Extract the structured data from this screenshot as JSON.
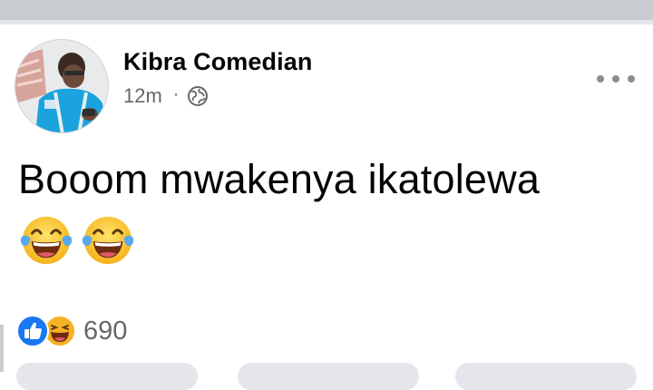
{
  "post": {
    "author": "Kibra Comedian",
    "time": "12m",
    "separator": "·",
    "privacy_icon": "globe-icon",
    "more_icon": "more-horizontal-icon",
    "text": "Booom mwakenya ikatolewa",
    "emojis": [
      "tears-of-joy-emoji",
      "tears-of-joy-emoji"
    ]
  },
  "reactions": {
    "icons": [
      "like-icon",
      "haha-icon"
    ],
    "count": "690"
  },
  "colors": {
    "like_blue": "#1877f2",
    "haha_yellow": "#f7b125",
    "secondary_text": "#65676b",
    "primary_text": "#050505"
  }
}
